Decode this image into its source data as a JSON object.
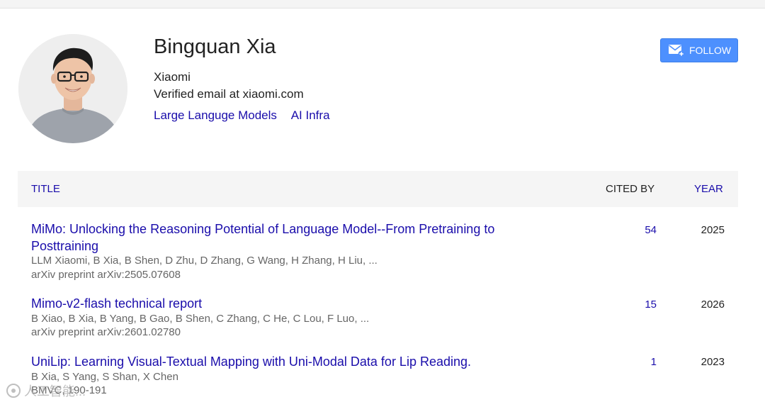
{
  "profile": {
    "name": "Bingquan Xia",
    "affiliation": "Xiaomi",
    "email": "Verified email at xiaomi.com",
    "interests": [
      "Large Languge Models",
      "AI Infra"
    ],
    "avatar_icon": "profile-photo"
  },
  "follow": {
    "label": "FOLLOW",
    "icon": "mail-plus-icon",
    "color": "#4d90fe"
  },
  "table": {
    "headers": {
      "title": "TITLE",
      "cited_by": "CITED BY",
      "year": "YEAR"
    },
    "rows": [
      {
        "title": "MiMo: Unlocking the Reasoning Potential of Language Model--From Pretraining to Posttraining",
        "authors": "LLM Xiaomi, B Xia, B Shen, D Zhu, D Zhang, G Wang, H Zhang, H Liu, ...",
        "venue": "arXiv preprint arXiv:2505.07608",
        "cited_by": "54",
        "year": "2025"
      },
      {
        "title": "Mimo-v2-flash technical report",
        "authors": "B Xiao, B Xia, B Yang, B Gao, B Shen, C Zhang, C He, C Lou, F Luo, ...",
        "venue": "arXiv preprint arXiv:2601.02780",
        "cited_by": "15",
        "year": "2026"
      },
      {
        "title": "UniLip: Learning Visual-Textual Mapping with Uni-Modal Data for Lip Reading.",
        "authors": "B Xia, S Yang, S Shan, X Chen",
        "venue": "BMVC, 190-191",
        "cited_by": "1",
        "year": "2023"
      }
    ]
  },
  "colors": {
    "link": "#1a0dab",
    "header_bg": "#f5f5f5",
    "meta_text": "#666666"
  },
  "watermark": {
    "text": "人工智能...",
    "icon": "watermark-logo-icon"
  }
}
